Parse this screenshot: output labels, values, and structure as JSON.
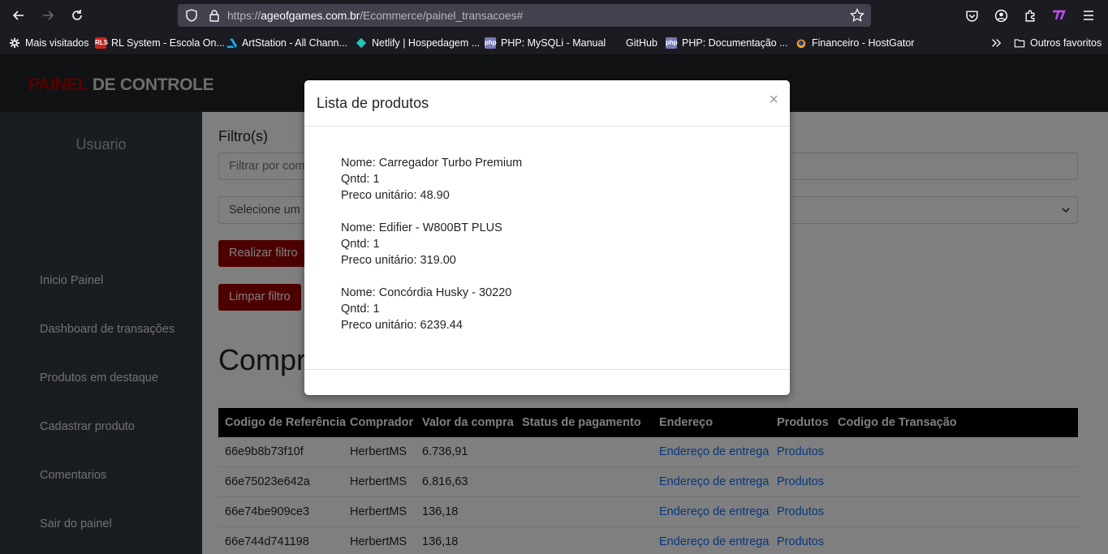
{
  "browser": {
    "url_prefix": "https://",
    "url_host": "ageofgames.com.br",
    "url_path": "/Ecommerce/painel_transacoes#",
    "bookmarks": [
      "Mais visitados",
      "RL System - Escola On...",
      "ArtStation - All Chann...",
      "Netlify | Hospedagem ...",
      "PHP: MySQLi - Manual",
      "GitHub",
      "PHP: Documentação ...",
      "Financeiro - HostGator"
    ],
    "other_bookmarks": "Outros favoritos"
  },
  "header": {
    "brand_red": "PAINEL",
    "brand_white": " DE CONTROLE"
  },
  "sidebar": {
    "user": "Usuario",
    "items": [
      "Inicio Painel",
      "Dashboard de transações",
      "Produtos em destaque",
      "Cadastrar produto",
      "Comentarios",
      "Sair do painel"
    ]
  },
  "filters": {
    "title": "Filtro(s)",
    "input_placeholder": "Filtrar por com",
    "select_value": "Selecione um s",
    "apply_label": "Realizar filtro",
    "clear_label": "Limpar filtro"
  },
  "section_title": "Compr",
  "table": {
    "headers": [
      "Codigo de Referência",
      "Comprador",
      "Valor da compra",
      "Status de pagamento",
      "Endereço",
      "Produtos",
      "Codigo de Transação"
    ],
    "rows": [
      {
        "ref": "66e9b8b73f10f",
        "buyer": "HerbertMS",
        "value": "6.736,91",
        "address": "Endereço de entrega",
        "products": "Produtos"
      },
      {
        "ref": "66e75023e642a",
        "buyer": "HerbertMS",
        "value": "6.816,63",
        "address": "Endereço de entrega",
        "products": "Produtos"
      },
      {
        "ref": "66e74be909ce3",
        "buyer": "HerbertMS",
        "value": "136,18",
        "address": "Endereço de entrega",
        "products": "Produtos"
      },
      {
        "ref": "66e744d741198",
        "buyer": "HerbertMS",
        "value": "136,18",
        "address": "Endereço de entrega",
        "products": "Produtos"
      }
    ]
  },
  "modal": {
    "title": "Lista de produtos",
    "close": "×",
    "products": [
      {
        "name": "Nome: Carregador Turbo Premium",
        "qty": "Qntd: 1",
        "price": "Preco unitário: 48.90"
      },
      {
        "name": "Nome: Edifier - W800BT PLUS",
        "qty": "Qntd: 1",
        "price": "Preco unitário: 319.00"
      },
      {
        "name": "Nome: Concórdia Husky - 30220",
        "qty": "Qntd: 1",
        "price": "Preco unitário: 6239.44"
      }
    ]
  },
  "colors": {
    "accent_red": "#9b0000",
    "brand_red": "#b30000",
    "link_blue": "#0d6efd",
    "sidebar_bg": "#343a40",
    "header_bg": "#212529"
  }
}
